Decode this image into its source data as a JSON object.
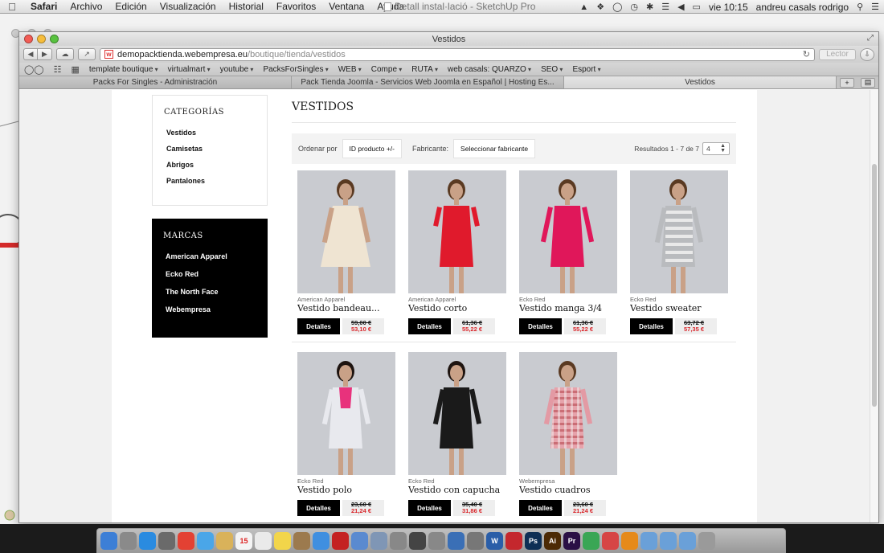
{
  "menubar": {
    "app": "Safari",
    "items": [
      "Archivo",
      "Edición",
      "Visualización",
      "Historial",
      "Favoritos",
      "Ventana",
      "Ayuda"
    ],
    "document_title": "Detall instal·lació - SketchUp Pro",
    "clock": "vie 10:15",
    "user": "andreu casals rodrigo"
  },
  "window": {
    "title": "Vestidos",
    "url_host": "demopacktienda.webempresa.eu",
    "url_path": "/boutique/tienda/vestidos",
    "reader_label": "Lector"
  },
  "bookmarks": [
    "template boutique",
    "virtualmart",
    "youtube",
    "PacksForSingles",
    "WEB",
    "Compe",
    "RUTA",
    "web casals: QUARZO",
    "SEO",
    "Esport"
  ],
  "tabs": [
    {
      "label": "Packs For Singles - Administración",
      "active": false
    },
    {
      "label": "Pack Tienda Joomla - Servicios Web Joomla en Español | Hosting Es...",
      "active": false
    },
    {
      "label": "Vestidos",
      "active": true
    }
  ],
  "sidebar": {
    "categories_title": "CATEGORÍAS",
    "categories": [
      "Vestidos",
      "Camisetas",
      "Abrigos",
      "Pantalones"
    ],
    "brands_title": "MARCAS",
    "brands": [
      "American Apparel",
      "Ecko Red",
      "The North Face",
      "Webempresa"
    ]
  },
  "main": {
    "heading": "VESTIDOS",
    "sort_label": "Ordenar por",
    "sort_value": "ID producto +/-",
    "maker_label": "Fabricante:",
    "maker_value": "Seleccionar fabricante",
    "results_text": "Resultados 1 - 7 de 7",
    "per_page": "4",
    "details_label": "Detalles"
  },
  "products": [
    {
      "brand": "American Apparel",
      "name": "Vestido bandeau...",
      "old_price": "59,00 €",
      "price": "53,10 €",
      "dress_color": "#efe4d2",
      "bg": "#c9cbd0"
    },
    {
      "brand": "American Apparel",
      "name": "Vestido corto",
      "old_price": "61,36 €",
      "price": "55,22 €",
      "dress_color": "#e01a2c",
      "bg": "#c9cbd0"
    },
    {
      "brand": "Ecko Red",
      "name": "Vestido manga 3/4",
      "old_price": "61,36 €",
      "price": "55,22 €",
      "dress_color": "#e0175a",
      "bg": "#c9cbd0"
    },
    {
      "brand": "Ecko Red",
      "name": "Vestido sweater",
      "old_price": "63,72 €",
      "price": "57,35 €",
      "dress_color": "#b9bbbe",
      "bg": "#c9cbd0"
    },
    {
      "brand": "Ecko Red",
      "name": "Vestido polo",
      "old_price": "23,60 €",
      "price": "21,24 €",
      "dress_color": "#e8e9ee",
      "bg": "#c9cbd0"
    },
    {
      "brand": "Ecko Red",
      "name": "Vestido con capucha",
      "old_price": "35,40 €",
      "price": "31,86 €",
      "dress_color": "#1a1a1a",
      "bg": "#c9cbd0"
    },
    {
      "brand": "Webempresa",
      "name": "Vestido cuadros",
      "old_price": "23,60 €",
      "price": "21,24 €",
      "dress_color": "#e39aa4",
      "bg": "#c9cbd0"
    }
  ],
  "dock": {
    "labeled_icons": [
      "15",
      "W",
      "Ps",
      "Ai",
      "Pr"
    ]
  }
}
